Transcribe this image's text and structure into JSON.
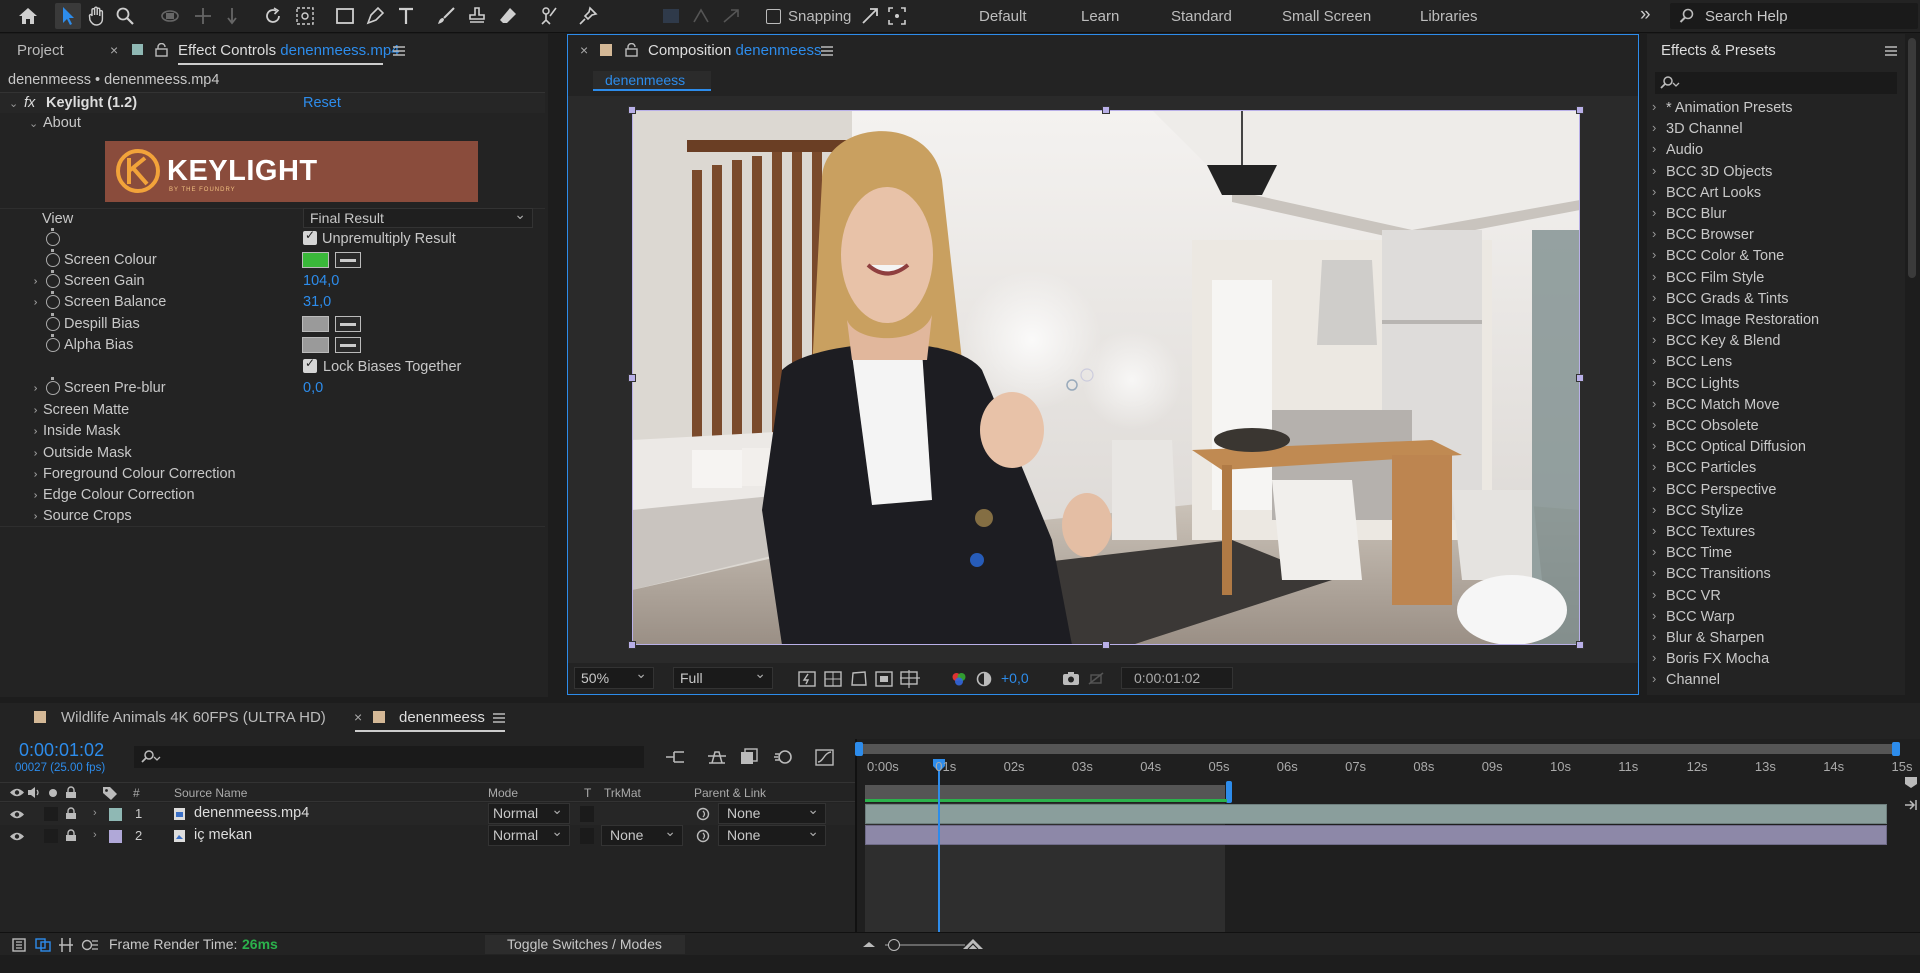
{
  "toolbar": {
    "snapping_label": "Snapping",
    "workspaces": [
      "Default",
      "Learn",
      "Standard",
      "Small Screen",
      "Libraries"
    ],
    "search_placeholder": "Search Help"
  },
  "left_panel": {
    "tab_project": "Project",
    "tab_effect_controls": "Effect Controls",
    "tab_effect_file": "denenmeess.mp4",
    "breadcrumb": "denenmeess • denenmeess.mp4",
    "effect_name": "Keylight (1.2)",
    "reset_label": "Reset",
    "about_label": "About",
    "logo_text": "KEYLIGHT",
    "logo_sub": "BY THE FOUNDRY",
    "view_label": "View",
    "view_value": "Final Result",
    "unpremultiply_label": "Unpremultiply Result",
    "screen_colour_label": "Screen Colour",
    "screen_colour": "#3ab83a",
    "screen_gain_label": "Screen Gain",
    "screen_gain_value": "104,0",
    "screen_balance_label": "Screen Balance",
    "screen_balance_value": "31,0",
    "despill_bias_label": "Despill Bias",
    "alpha_bias_label": "Alpha Bias",
    "lock_biases_label": "Lock Biases Together",
    "screen_preblur_label": "Screen Pre-blur",
    "screen_preblur_value": "0,0",
    "groups": [
      "Screen Matte",
      "Inside Mask",
      "Outside Mask",
      "Foreground Colour Correction",
      "Edge Colour Correction",
      "Source Crops"
    ]
  },
  "composition": {
    "tab_label": "Composition",
    "tab_name": "denenmeess",
    "sub_tab": "denenmeess",
    "zoom": "50%",
    "resolution": "Full",
    "exposure": "+0,0",
    "timecode": "0:00:01:02"
  },
  "effects_presets": {
    "title": "Effects & Presets",
    "items": [
      "* Animation Presets",
      "3D Channel",
      "Audio",
      "BCC 3D Objects",
      "BCC Art Looks",
      "BCC Blur",
      "BCC Browser",
      "BCC Color & Tone",
      "BCC Film Style",
      "BCC Grads & Tints",
      "BCC Image Restoration",
      "BCC Key & Blend",
      "BCC Lens",
      "BCC Lights",
      "BCC Match Move",
      "BCC Obsolete",
      "BCC Optical Diffusion",
      "BCC Particles",
      "BCC Perspective",
      "BCC Stylize",
      "BCC Textures",
      "BCC Time",
      "BCC Transitions",
      "BCC VR",
      "BCC Warp",
      "Blur & Sharpen",
      "Boris FX Mocha",
      "Channel"
    ]
  },
  "timeline": {
    "tab_other": "Wildlife Animals 4K 60FPS (ULTRA HD)",
    "tab_active": "denenmeess",
    "timecode": "0:00:01:02",
    "frame_info": "00027 (25.00 fps)",
    "col_hash": "#",
    "col_source": "Source Name",
    "col_mode": "Mode",
    "col_t": "T",
    "col_trkmat": "TrkMat",
    "col_parent": "Parent & Link",
    "layers": [
      {
        "num": "1",
        "name": "denenmeess.mp4",
        "mode": "Normal",
        "trkmat": "",
        "parent": "None",
        "color": "#8fb8b4"
      },
      {
        "num": "2",
        "name": "iç mekan",
        "mode": "Normal",
        "trkmat": "None",
        "parent": "None",
        "color": "#b0a8d8"
      }
    ],
    "ruler": [
      "0:00s",
      "01s",
      "02s",
      "03s",
      "04s",
      "05s",
      "06s",
      "07s",
      "08s",
      "09s",
      "10s",
      "11s",
      "12s",
      "13s",
      "14s",
      "15s"
    ],
    "frame_render_label": "Frame Render Time:",
    "frame_render_value": "26ms",
    "toggle_label": "Toggle Switches / Modes"
  }
}
